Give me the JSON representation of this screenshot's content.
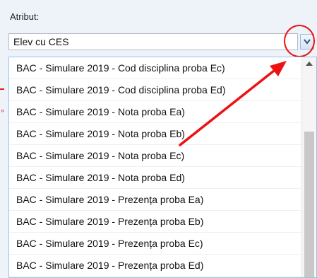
{
  "field": {
    "label": "Atribut:",
    "selected_value": "Elev cu CES"
  },
  "dropdown": {
    "items": [
      "BAC - Simulare 2019 - Cod disciplina proba Ec)",
      "BAC - Simulare 2019 - Cod disciplina proba Ed)",
      "BAC - Simulare 2019 - Nota proba Ea)",
      "BAC - Simulare 2019 - Nota proba Eb)",
      "BAC - Simulare 2019 - Nota proba Ec)",
      "BAC - Simulare 2019 - Nota proba Ed)",
      "BAC - Simulare 2019 - Prezența proba Ea)",
      "BAC - Simulare 2019 - Prezența proba Eb)",
      "BAC - Simulare 2019 - Prezența proba Ec)",
      "BAC - Simulare 2019 - Prezența proba Ed)"
    ]
  },
  "icons": {
    "trigger": "chevron-down-icon",
    "annotation": "red-arrow-icon"
  },
  "colors": {
    "panel_bg": "#eef3fa",
    "accent_border": "#98c0f4",
    "annotation_red": "#e11"
  }
}
